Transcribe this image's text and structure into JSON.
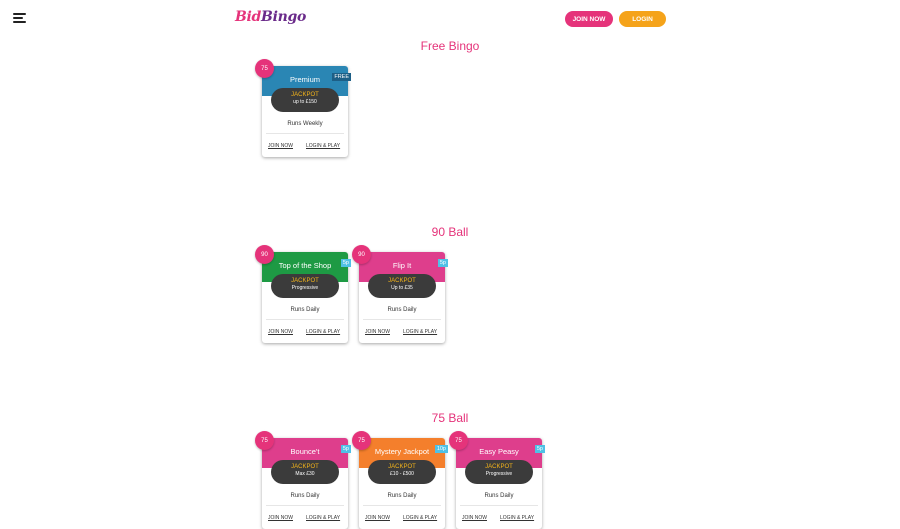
{
  "header": {
    "logo_part1": "Bid",
    "logo_part2": "Bingo",
    "join_label": "JOIN NOW",
    "login_label": "LOGIN"
  },
  "colors": {
    "brand_pink": "#e5337a",
    "brand_orange": "#f5a31a",
    "free_band": "#2a86b4",
    "green_band": "#1e9a44",
    "pink_band": "#de3e8c",
    "orange_band": "#f47f2c",
    "price_tag": "#4fc1e6"
  },
  "sections": [
    {
      "title": "Free Bingo",
      "cards": [
        {
          "ball": "75",
          "name": "Premium",
          "tag": "FREE",
          "jackpot_label": "JACKPOT",
          "jackpot_value": "up to £150",
          "runs": "Runs Weekly",
          "join": "JOIN NOW",
          "login": "LOGIN & PLAY",
          "band_color": "#2a86b4",
          "tag_color": "#1d5f86"
        }
      ]
    },
    {
      "title": "90 Ball",
      "cards": [
        {
          "ball": "90",
          "name": "Top of the Shop",
          "tag": "5p",
          "jackpot_label": "JACKPOT",
          "jackpot_value": "Progressive",
          "runs": "Runs Daily",
          "join": "JOIN NOW",
          "login": "LOGIN & PLAY",
          "band_color": "#1e9a44",
          "tag_color": "#4fc1e6"
        },
        {
          "ball": "90",
          "name": "Flip It",
          "tag": "5p",
          "jackpot_label": "JACKPOT",
          "jackpot_value": "Up to £35",
          "runs": "Runs Daily",
          "join": "JOIN NOW",
          "login": "LOGIN & PLAY",
          "band_color": "#de3e8c",
          "tag_color": "#4fc1e6"
        }
      ]
    },
    {
      "title": "75 Ball",
      "cards": [
        {
          "ball": "75",
          "name": "Bounce't",
          "tag": "5p",
          "jackpot_label": "JACKPOT",
          "jackpot_value": "Max £30",
          "runs": "Runs Daily",
          "join": "JOIN NOW",
          "login": "LOGIN & PLAY",
          "band_color": "#de3e8c",
          "tag_color": "#4fc1e6"
        },
        {
          "ball": "75",
          "name": "Mystery Jackpot",
          "tag": "10p",
          "jackpot_label": "JACKPOT",
          "jackpot_value": "£10 - £500",
          "runs": "Runs Daily",
          "join": "JOIN NOW",
          "login": "LOGIN & PLAY",
          "band_color": "#f47f2c",
          "tag_color": "#4fc1e6"
        },
        {
          "ball": "75",
          "name": "Easy Peasy",
          "tag": "5p",
          "jackpot_label": "JACKPOT",
          "jackpot_value": "Progressive",
          "runs": "Runs Daily",
          "join": "JOIN NOW",
          "login": "LOGIN & PLAY",
          "band_color": "#de3e8c",
          "tag_color": "#4fc1e6"
        }
      ]
    }
  ]
}
